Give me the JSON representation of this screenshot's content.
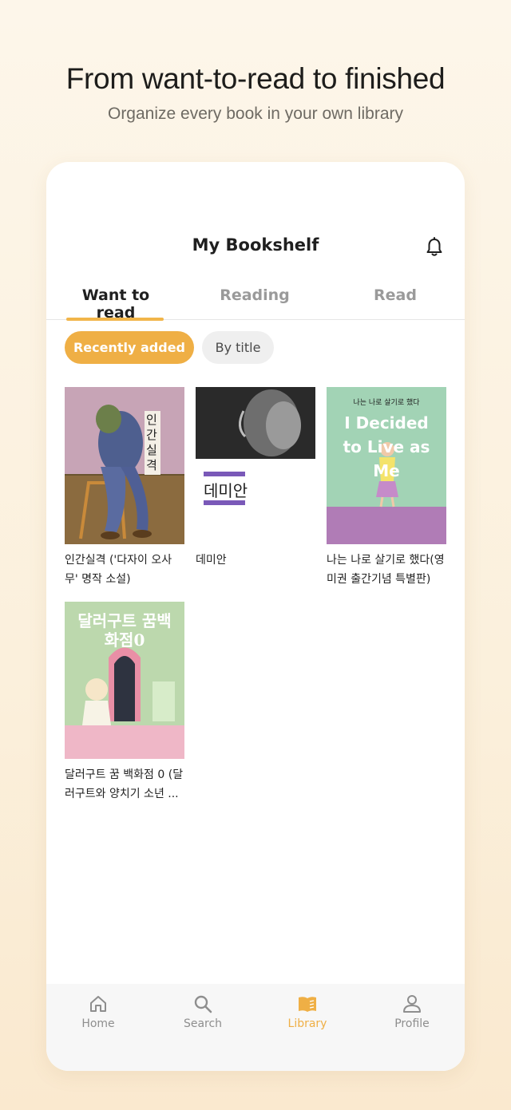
{
  "hero": {
    "title": "From want-to-read to finished",
    "subtitle": "Organize every book in your own library"
  },
  "header": {
    "title": "My Bookshelf",
    "bell_icon": "bell-icon"
  },
  "tabs": [
    {
      "label": "Want to read",
      "active": true
    },
    {
      "label": "Reading",
      "active": false
    },
    {
      "label": "Read",
      "active": false
    }
  ],
  "sort_chips": [
    {
      "label": "Recently added",
      "active": true
    },
    {
      "label": "By title",
      "active": false
    }
  ],
  "books": [
    {
      "title": "인간실격 ('다자이 오사무' 명작 소설)",
      "cover_text": "인간실격"
    },
    {
      "title": "데미안",
      "cover_text": "데미안"
    },
    {
      "title": "나는 나로 살기로 했다(영미권 출간기념 특별판) (...",
      "cover_text": "I Decided to Live as Me",
      "cover_top": "나는 나로 살기로 했다"
    },
    {
      "title": "달러구트 꿈 백화점 0 (달러구트와 양치기 소년 ...",
      "cover_text": "달러구트 꿈백화점0"
    }
  ],
  "bottom_nav": [
    {
      "label": "Home",
      "icon": "home-icon",
      "active": false
    },
    {
      "label": "Search",
      "icon": "search-icon",
      "active": false
    },
    {
      "label": "Library",
      "icon": "library-icon",
      "active": true
    },
    {
      "label": "Profile",
      "icon": "profile-icon",
      "active": false
    }
  ],
  "colors": {
    "accent": "#efaf45",
    "background": "#fdf6ea"
  }
}
